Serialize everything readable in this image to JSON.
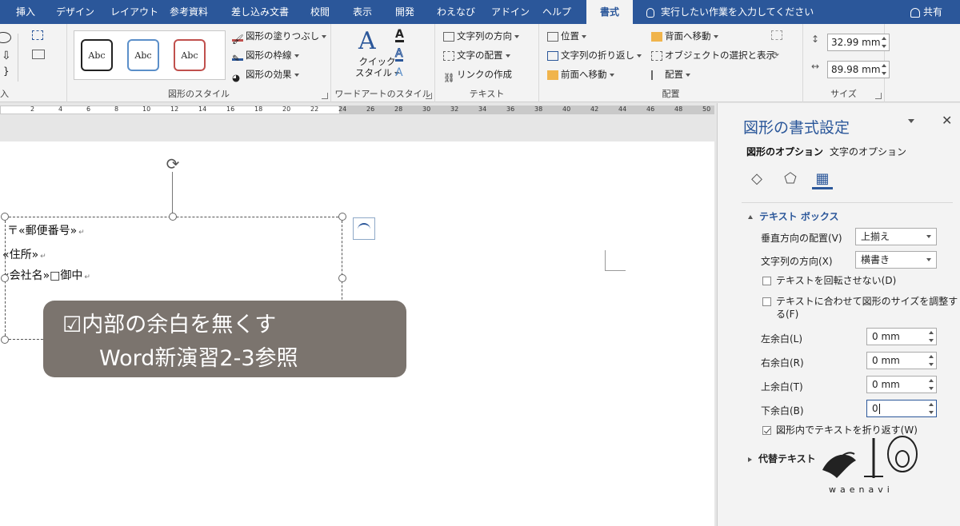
{
  "tabs": [
    {
      "label": "挿入"
    },
    {
      "label": "デザイン"
    },
    {
      "label": "レイアウト"
    },
    {
      "label": "参考資料"
    },
    {
      "label": "差し込み文書"
    },
    {
      "label": "校閲"
    },
    {
      "label": "表示"
    },
    {
      "label": "開発"
    },
    {
      "label": "わえなび"
    },
    {
      "label": "アドイン"
    },
    {
      "label": "ヘルプ"
    },
    {
      "label": "書式"
    }
  ],
  "tell_me": "実行したい作業を入力してください",
  "share": "共有",
  "ribbon": {
    "insert_fragment": "入",
    "shape_styles": {
      "swatch_text": "Abc",
      "fill": "図形の塗りつぶし",
      "outline": "図形の枠線",
      "effects": "図形の効果",
      "label": "図形のスタイル"
    },
    "wordart": {
      "quick_style": "クイック\nスタイル",
      "quick_style_1": "クイック",
      "quick_style_2": "スタイル",
      "label": "ワードアートのスタイル"
    },
    "text": {
      "direction": "文字列の方向",
      "align": "文字の配置",
      "link": "リンクの作成",
      "label": "テキスト"
    },
    "arrange": {
      "position": "位置",
      "wrap": "文字列の折り返し",
      "forward": "前面へ移動",
      "backward": "背面へ移動",
      "selection": "オブジェクトの選択と表示",
      "align": "配置",
      "label": "配置"
    },
    "size": {
      "height": "32.99 mm",
      "width": "89.98 mm",
      "label": "サイズ"
    }
  },
  "ruler_numbers": [
    "2",
    "4",
    "6",
    "8",
    "10",
    "12",
    "14",
    "16",
    "18",
    "20",
    "22",
    "24",
    "26",
    "28",
    "30",
    "32",
    "34",
    "36",
    "38",
    "40",
    "42",
    "44",
    "46",
    "48",
    "50"
  ],
  "document": {
    "lines": [
      "〒«郵便番号»",
      "«住所»",
      "«会社名»□御中"
    ],
    "para_mark": "↵"
  },
  "caption": {
    "line1": "☑内部の余白を無くす",
    "line2": "Word新演習2-3参照"
  },
  "pane": {
    "title": "図形の書式設定",
    "tab_shape": "図形のオプション",
    "tab_text": "文字のオプション",
    "section_textbox": "テキスト ボックス",
    "vertical_align_label": "垂直方向の配置(V)",
    "vertical_align_value": "上揃え",
    "text_direction_label": "文字列の方向(X)",
    "text_direction_value": "横書き",
    "no_rotate": "テキストを回転させない(D)",
    "resize_shape_1": "テキストに合わせて図形のサイズを調整す",
    "resize_shape_2": "る(F)",
    "left_margin_label": "左余白(L)",
    "left_margin_value": "0 mm",
    "right_margin_label": "右余白(R)",
    "right_margin_value": "0 mm",
    "top_margin_label": "上余白(T)",
    "top_margin_value": "0 mm",
    "bottom_margin_label": "下余白(B)",
    "bottom_margin_value": "0",
    "wrap_text": "図形内でテキストを折り返す(W)",
    "alt_text": "代替テキスト"
  },
  "watermark": "waenavi",
  "colors": {
    "accent": "#2b579a",
    "caption_bg": "#7b746e"
  }
}
